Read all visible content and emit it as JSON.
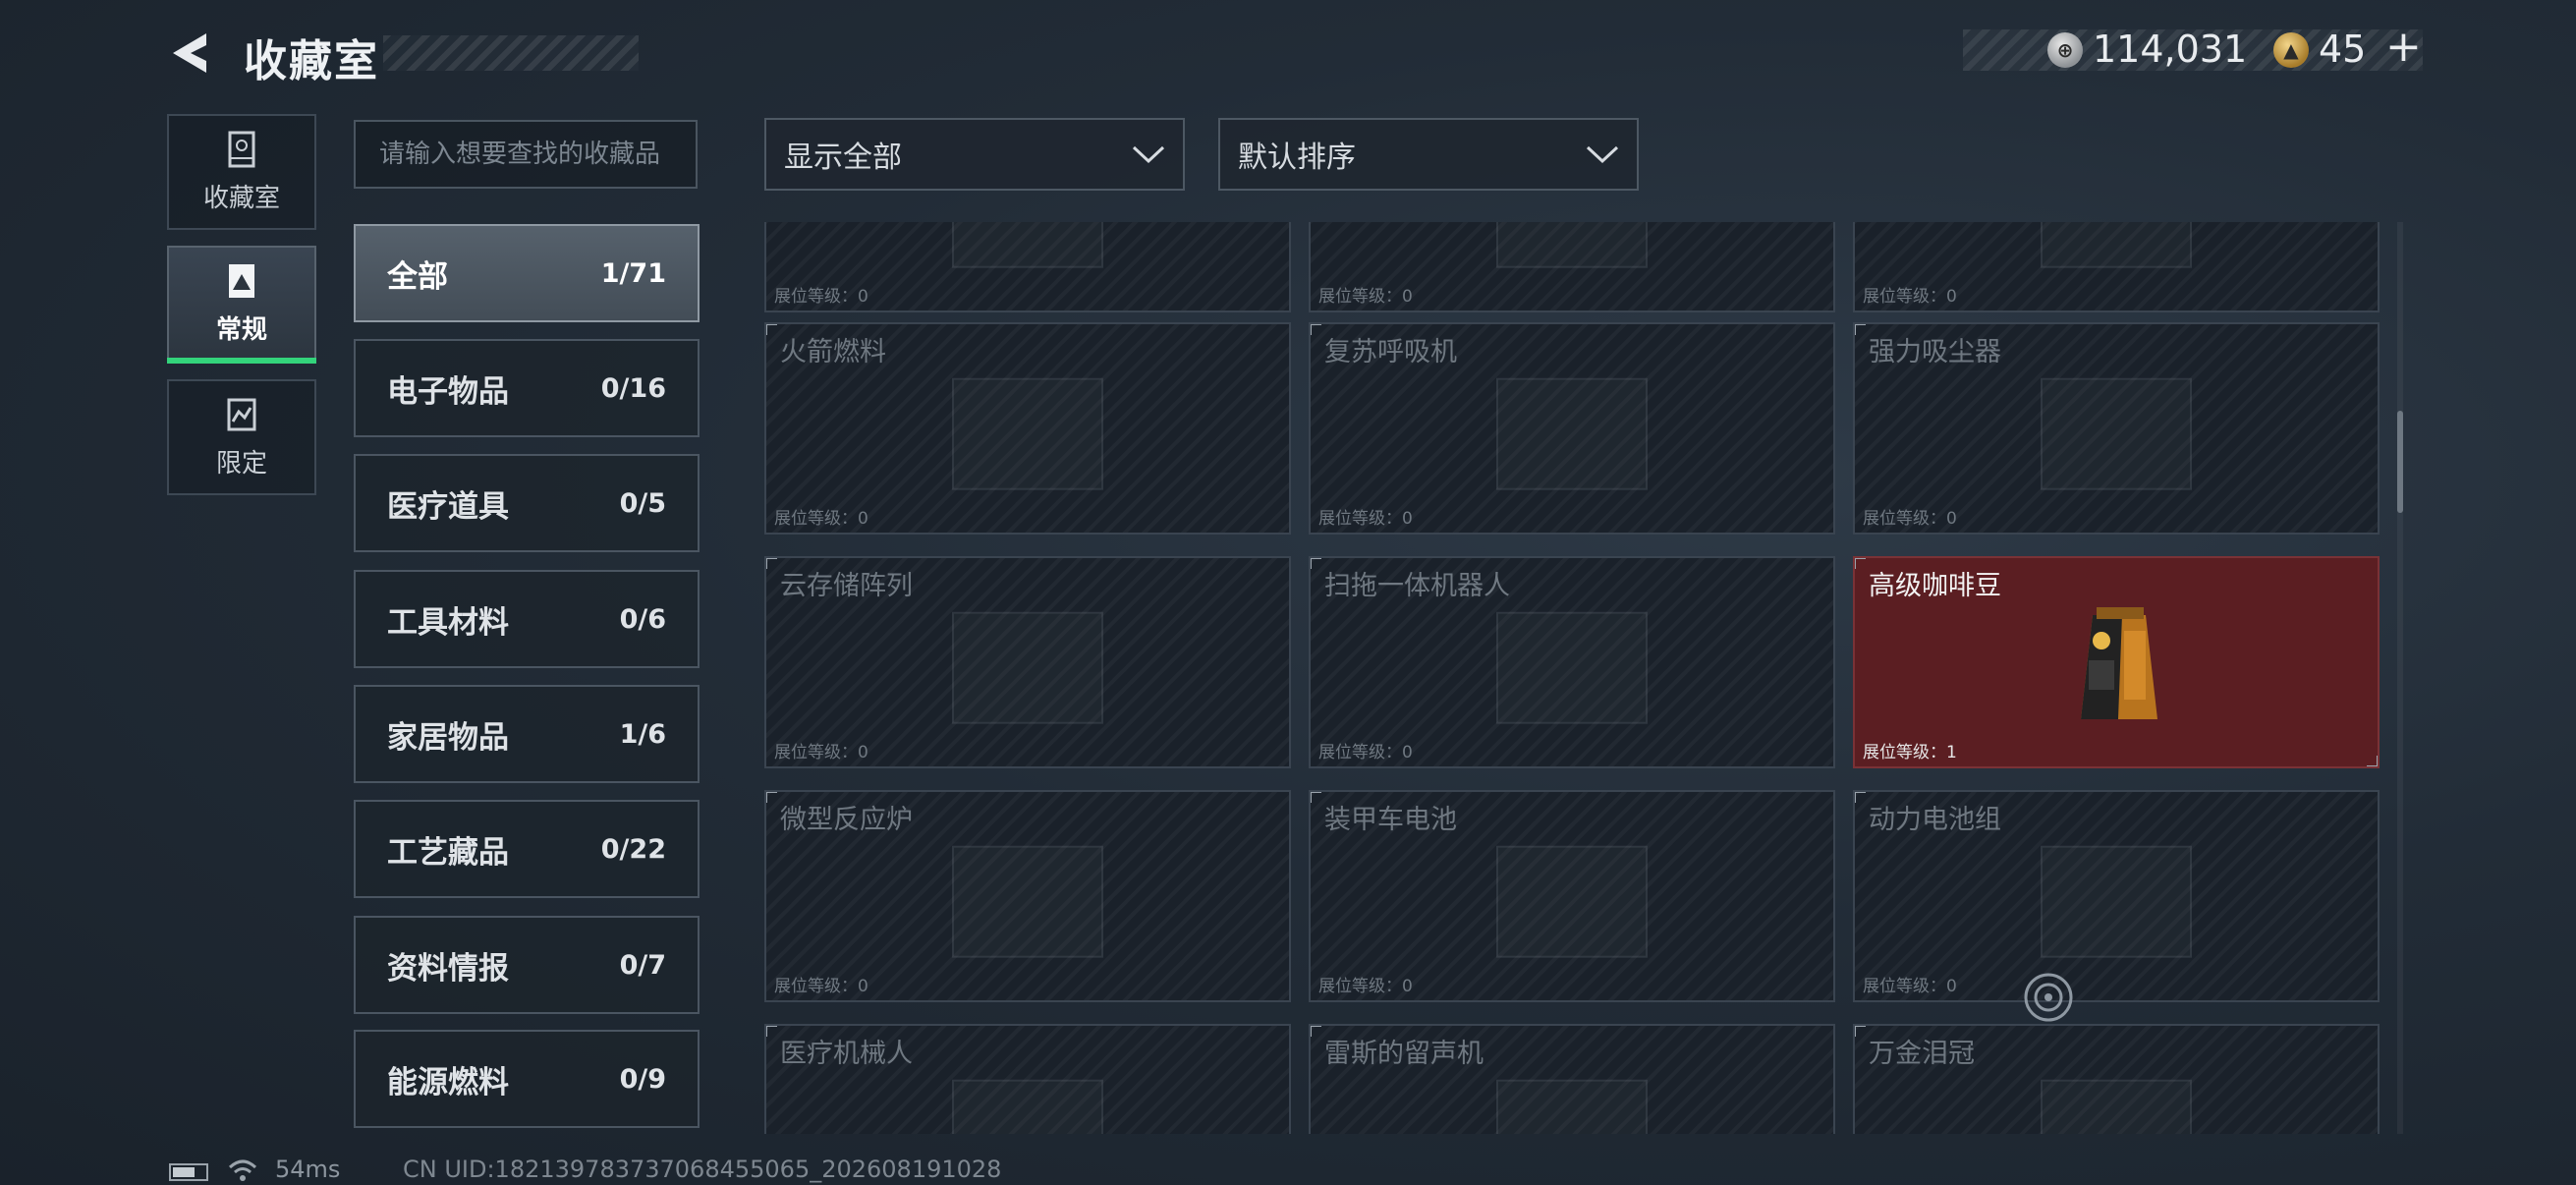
{
  "header": {
    "title": "收藏室"
  },
  "currency": [
    {
      "icon": "silver-coin-icon",
      "value": "114,031"
    },
    {
      "icon": "gold-coin-icon",
      "value": "45",
      "add_label": "+"
    }
  ],
  "nav": [
    {
      "label": "收藏室",
      "icon": "display-case-icon"
    },
    {
      "label": "常规",
      "icon": "card-icon"
    },
    {
      "label": "限定",
      "icon": "limited-icon"
    }
  ],
  "search": {
    "placeholder": "请输入想要查找的收藏品"
  },
  "filters": {
    "show": "显示全部",
    "sort": "默认排序"
  },
  "categories": [
    {
      "name": "全部",
      "count": "1/71"
    },
    {
      "name": "电子物品",
      "count": "0/16"
    },
    {
      "name": "医疗道具",
      "count": "0/5"
    },
    {
      "name": "工具材料",
      "count": "0/6"
    },
    {
      "name": "家居物品",
      "count": "1/6"
    },
    {
      "name": "工艺藏品",
      "count": "0/22"
    },
    {
      "name": "资料情报",
      "count": "0/7"
    },
    {
      "name": "能源燃料",
      "count": "0/9"
    }
  ],
  "level_label": "展位等级：",
  "items": [
    {
      "name": "",
      "level": "0"
    },
    {
      "name": "",
      "level": "0"
    },
    {
      "name": "",
      "level": "0"
    },
    {
      "name": "火箭燃料",
      "level": "0"
    },
    {
      "name": "复苏呼吸机",
      "level": "0"
    },
    {
      "name": "强力吸尘器",
      "level": "0"
    },
    {
      "name": "云存储阵列",
      "level": "0"
    },
    {
      "name": "扫拖一体机器人",
      "level": "0"
    },
    {
      "name": "高级咖啡豆",
      "level": "1",
      "owned": true
    },
    {
      "name": "微型反应炉",
      "level": "0"
    },
    {
      "name": "装甲车电池",
      "level": "0"
    },
    {
      "name": "动力电池组",
      "level": "0"
    },
    {
      "name": "医疗机械人",
      "level": ""
    },
    {
      "name": "雷斯的留声机",
      "level": ""
    },
    {
      "name": "万金泪冠",
      "level": ""
    }
  ],
  "status": {
    "ping": "54ms",
    "uid": "CN UID:18213978373706845506​5_202608191028"
  },
  "colors": {
    "accent_green": "#33d47b",
    "owned_card": "#5b1e22"
  }
}
